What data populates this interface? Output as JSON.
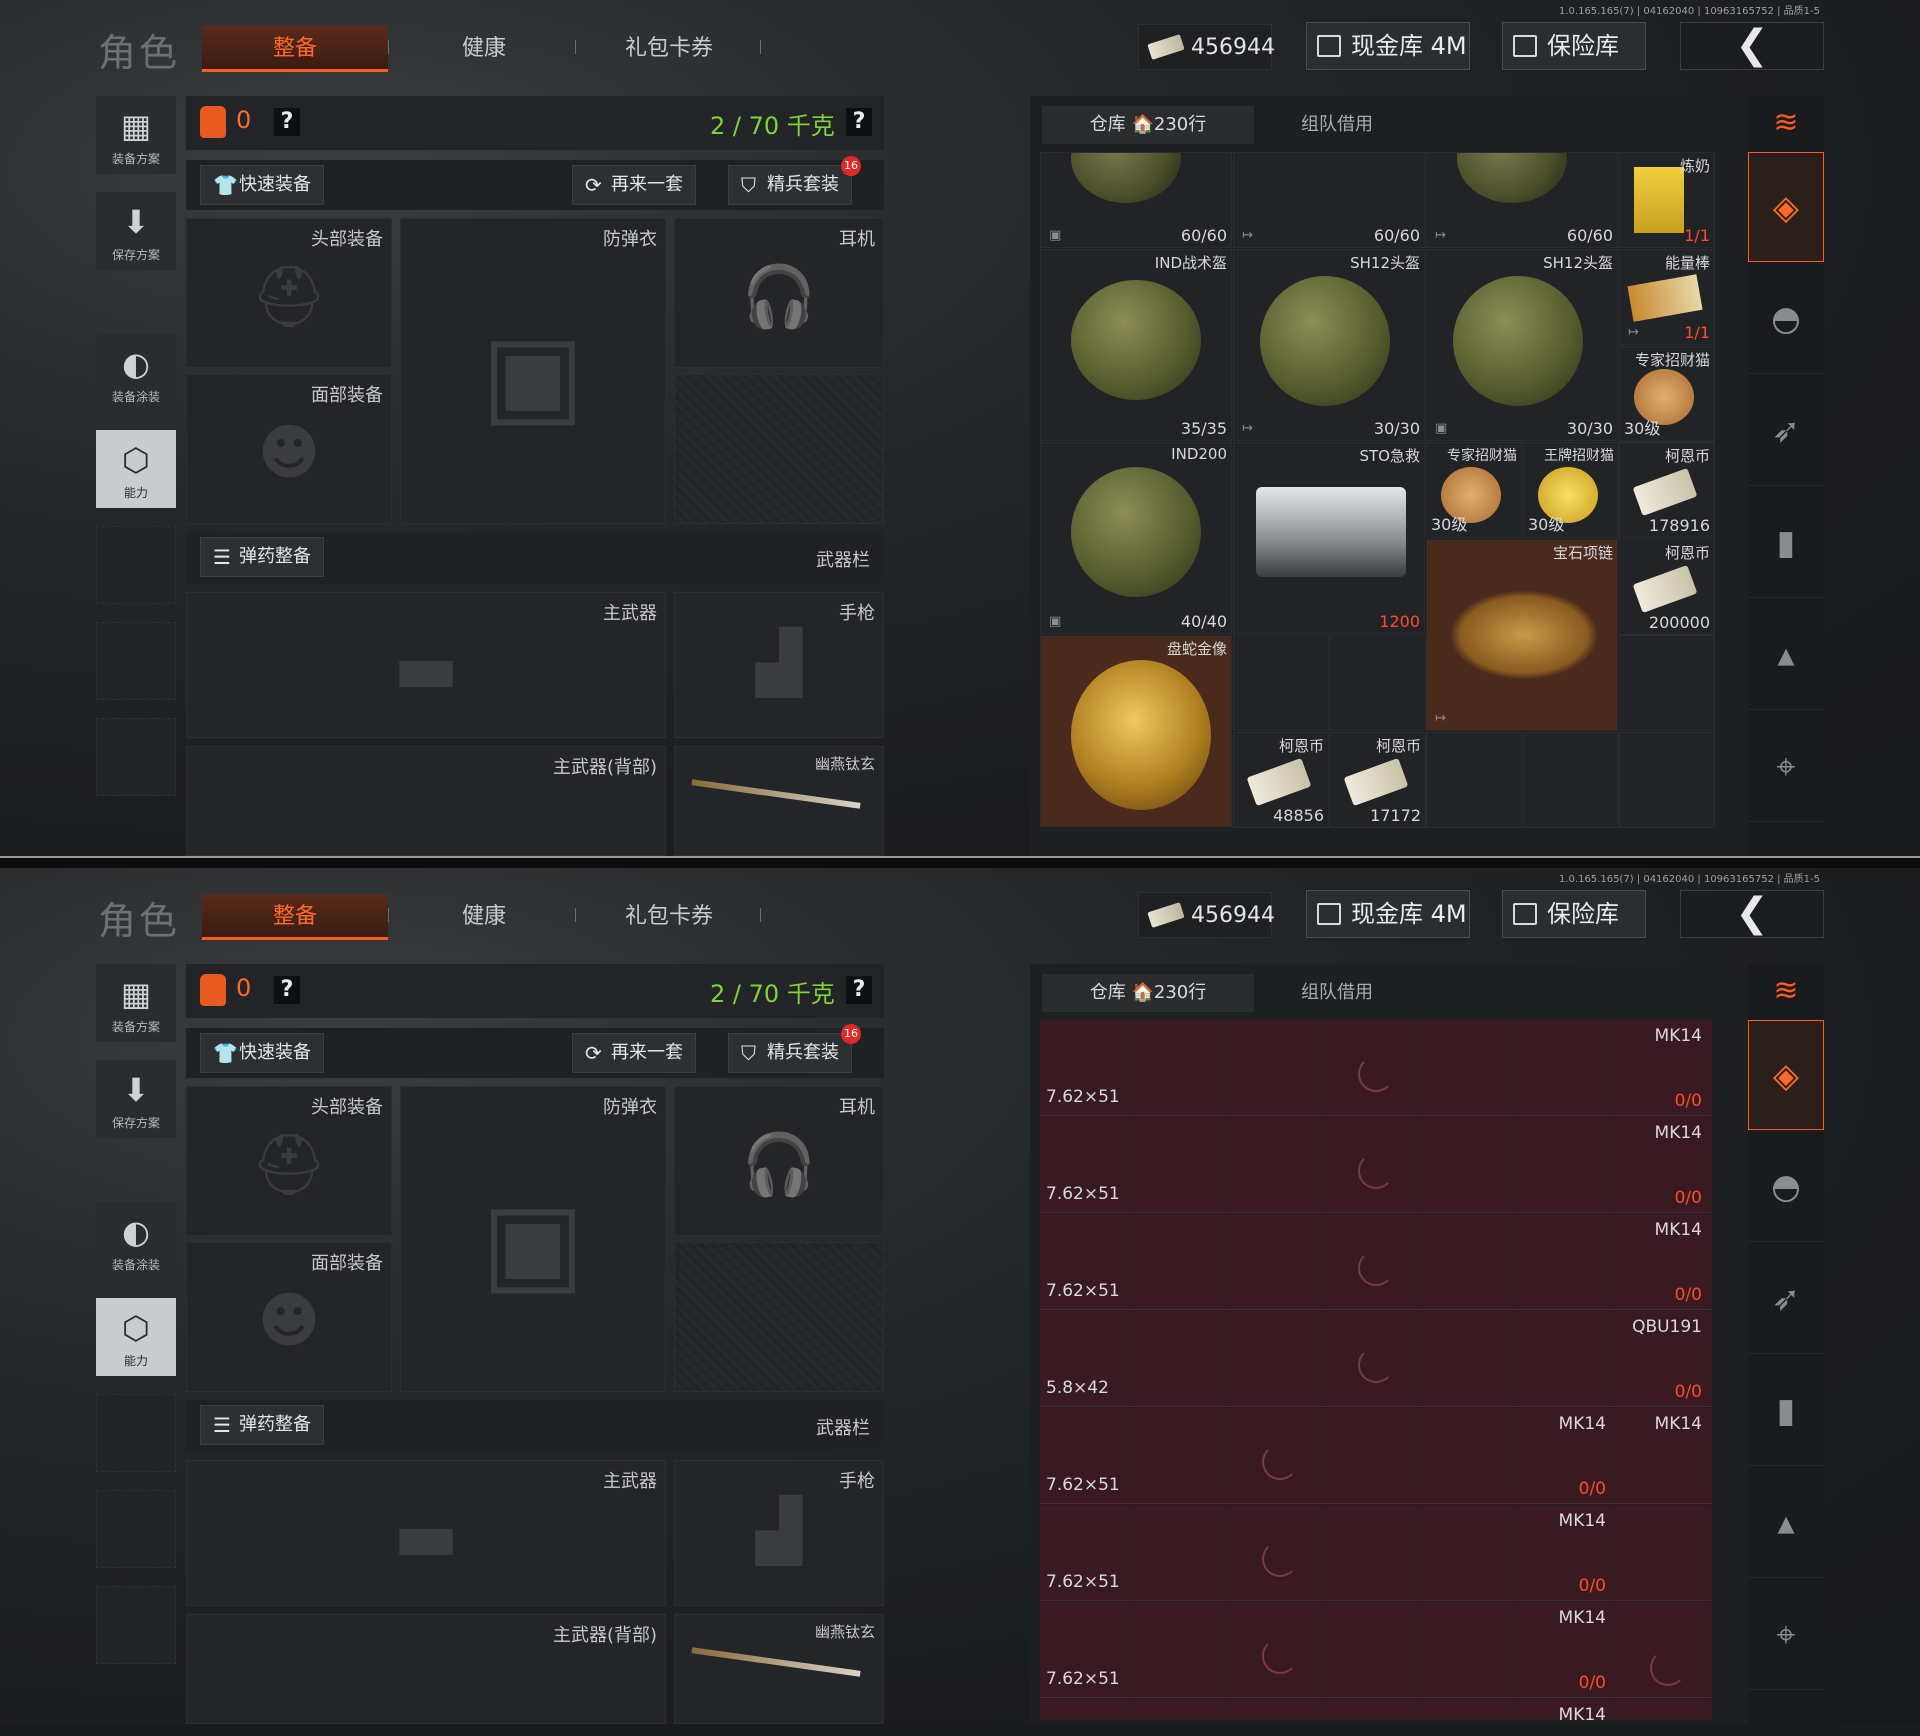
{
  "version": "1.0.165.165(7) | 04162040 | 10963165752 | 品质1-5",
  "title": "角色",
  "tabs": [
    "整备",
    "健康",
    "礼包卡券"
  ],
  "currency": "456944",
  "cash_button": "现金库 4M",
  "safe_button": "保险库",
  "back_glyph": "❮",
  "left_nav": [
    {
      "label": "装备方案",
      "icon": "vest-icon"
    },
    {
      "label": "保存方案",
      "icon": "download-icon"
    },
    {
      "label": "装备涂装",
      "icon": "helmet-paint-icon"
    },
    {
      "label": "能力",
      "icon": "ability-icon"
    }
  ],
  "carry_count": "0",
  "help": "?",
  "weight": "2 / 70 千克",
  "quick_equip": "快速装备",
  "again": "再来一套",
  "elite_set": "精兵套装",
  "elite_badge": "16",
  "slots": {
    "head": "头部装备",
    "armor": "防弹衣",
    "ear": "耳机",
    "face": "面部装备",
    "ammo": "弹药整备",
    "weapon_bar": "武器栏",
    "main": "主武器",
    "pistol": "手枪",
    "main_back": "主武器(背部)",
    "melee": "幽燕钛玄"
  },
  "warehouse_tab": "仓库 🏠230行",
  "team_tab": "组队借用",
  "items": {
    "r0c0": "60/60",
    "r0c1": "60/60",
    "r0c2": "60/60",
    "r0c3_name": "炼奶",
    "r0c3_q": "1/1",
    "ind_helmet": "IND战术盔",
    "ind_q": "35/35",
    "sh12a": "SH12头盔",
    "sh12a_q": "30/30",
    "sh12b": "SH12头盔",
    "sh12b_q": "30/30",
    "energy": "能量棒",
    "energy_q": "1/1",
    "expert1": "专家招财猫",
    "expert1_lvl": "30级",
    "ind200": "IND200",
    "ind200_q": "40/40",
    "sto": "STO急救",
    "sto_q": "1200",
    "expert2": "专家招财猫",
    "expert2_lvl": "30级",
    "ace": "王牌招财猫",
    "ace_lvl": "30级",
    "coin1": "柯恩币",
    "coin1_q": "178916",
    "necklace": "宝石项链",
    "coin2": "柯恩币",
    "coin2_q": "200000",
    "snake": "盘蛇金像",
    "coin3": "柯恩币",
    "coin3_q": "48856",
    "coin4": "柯恩币",
    "coin4_q": "17172"
  },
  "ammo_rows": [
    {
      "cal": "7.62×51",
      "w": "MK14",
      "c": "0/0"
    },
    {
      "cal": "7.62×51",
      "w": "MK14",
      "c": "0/0"
    },
    {
      "cal": "7.62×51",
      "w": "MK14",
      "c": "0/0"
    },
    {
      "cal": "5.8×42",
      "w": "QBU191",
      "c": "0/0"
    },
    {
      "cal": "7.62×51",
      "w": "MK14",
      "c": "0/0",
      "w2": "MK14",
      "c2": "0/0"
    },
    {
      "cal": "7.62×51",
      "w2": "MK14",
      "c2": "0/0"
    },
    {
      "cal": "7.62×51",
      "w2": "MK14",
      "c2": "0/0"
    },
    {
      "w": "MK14"
    }
  ]
}
